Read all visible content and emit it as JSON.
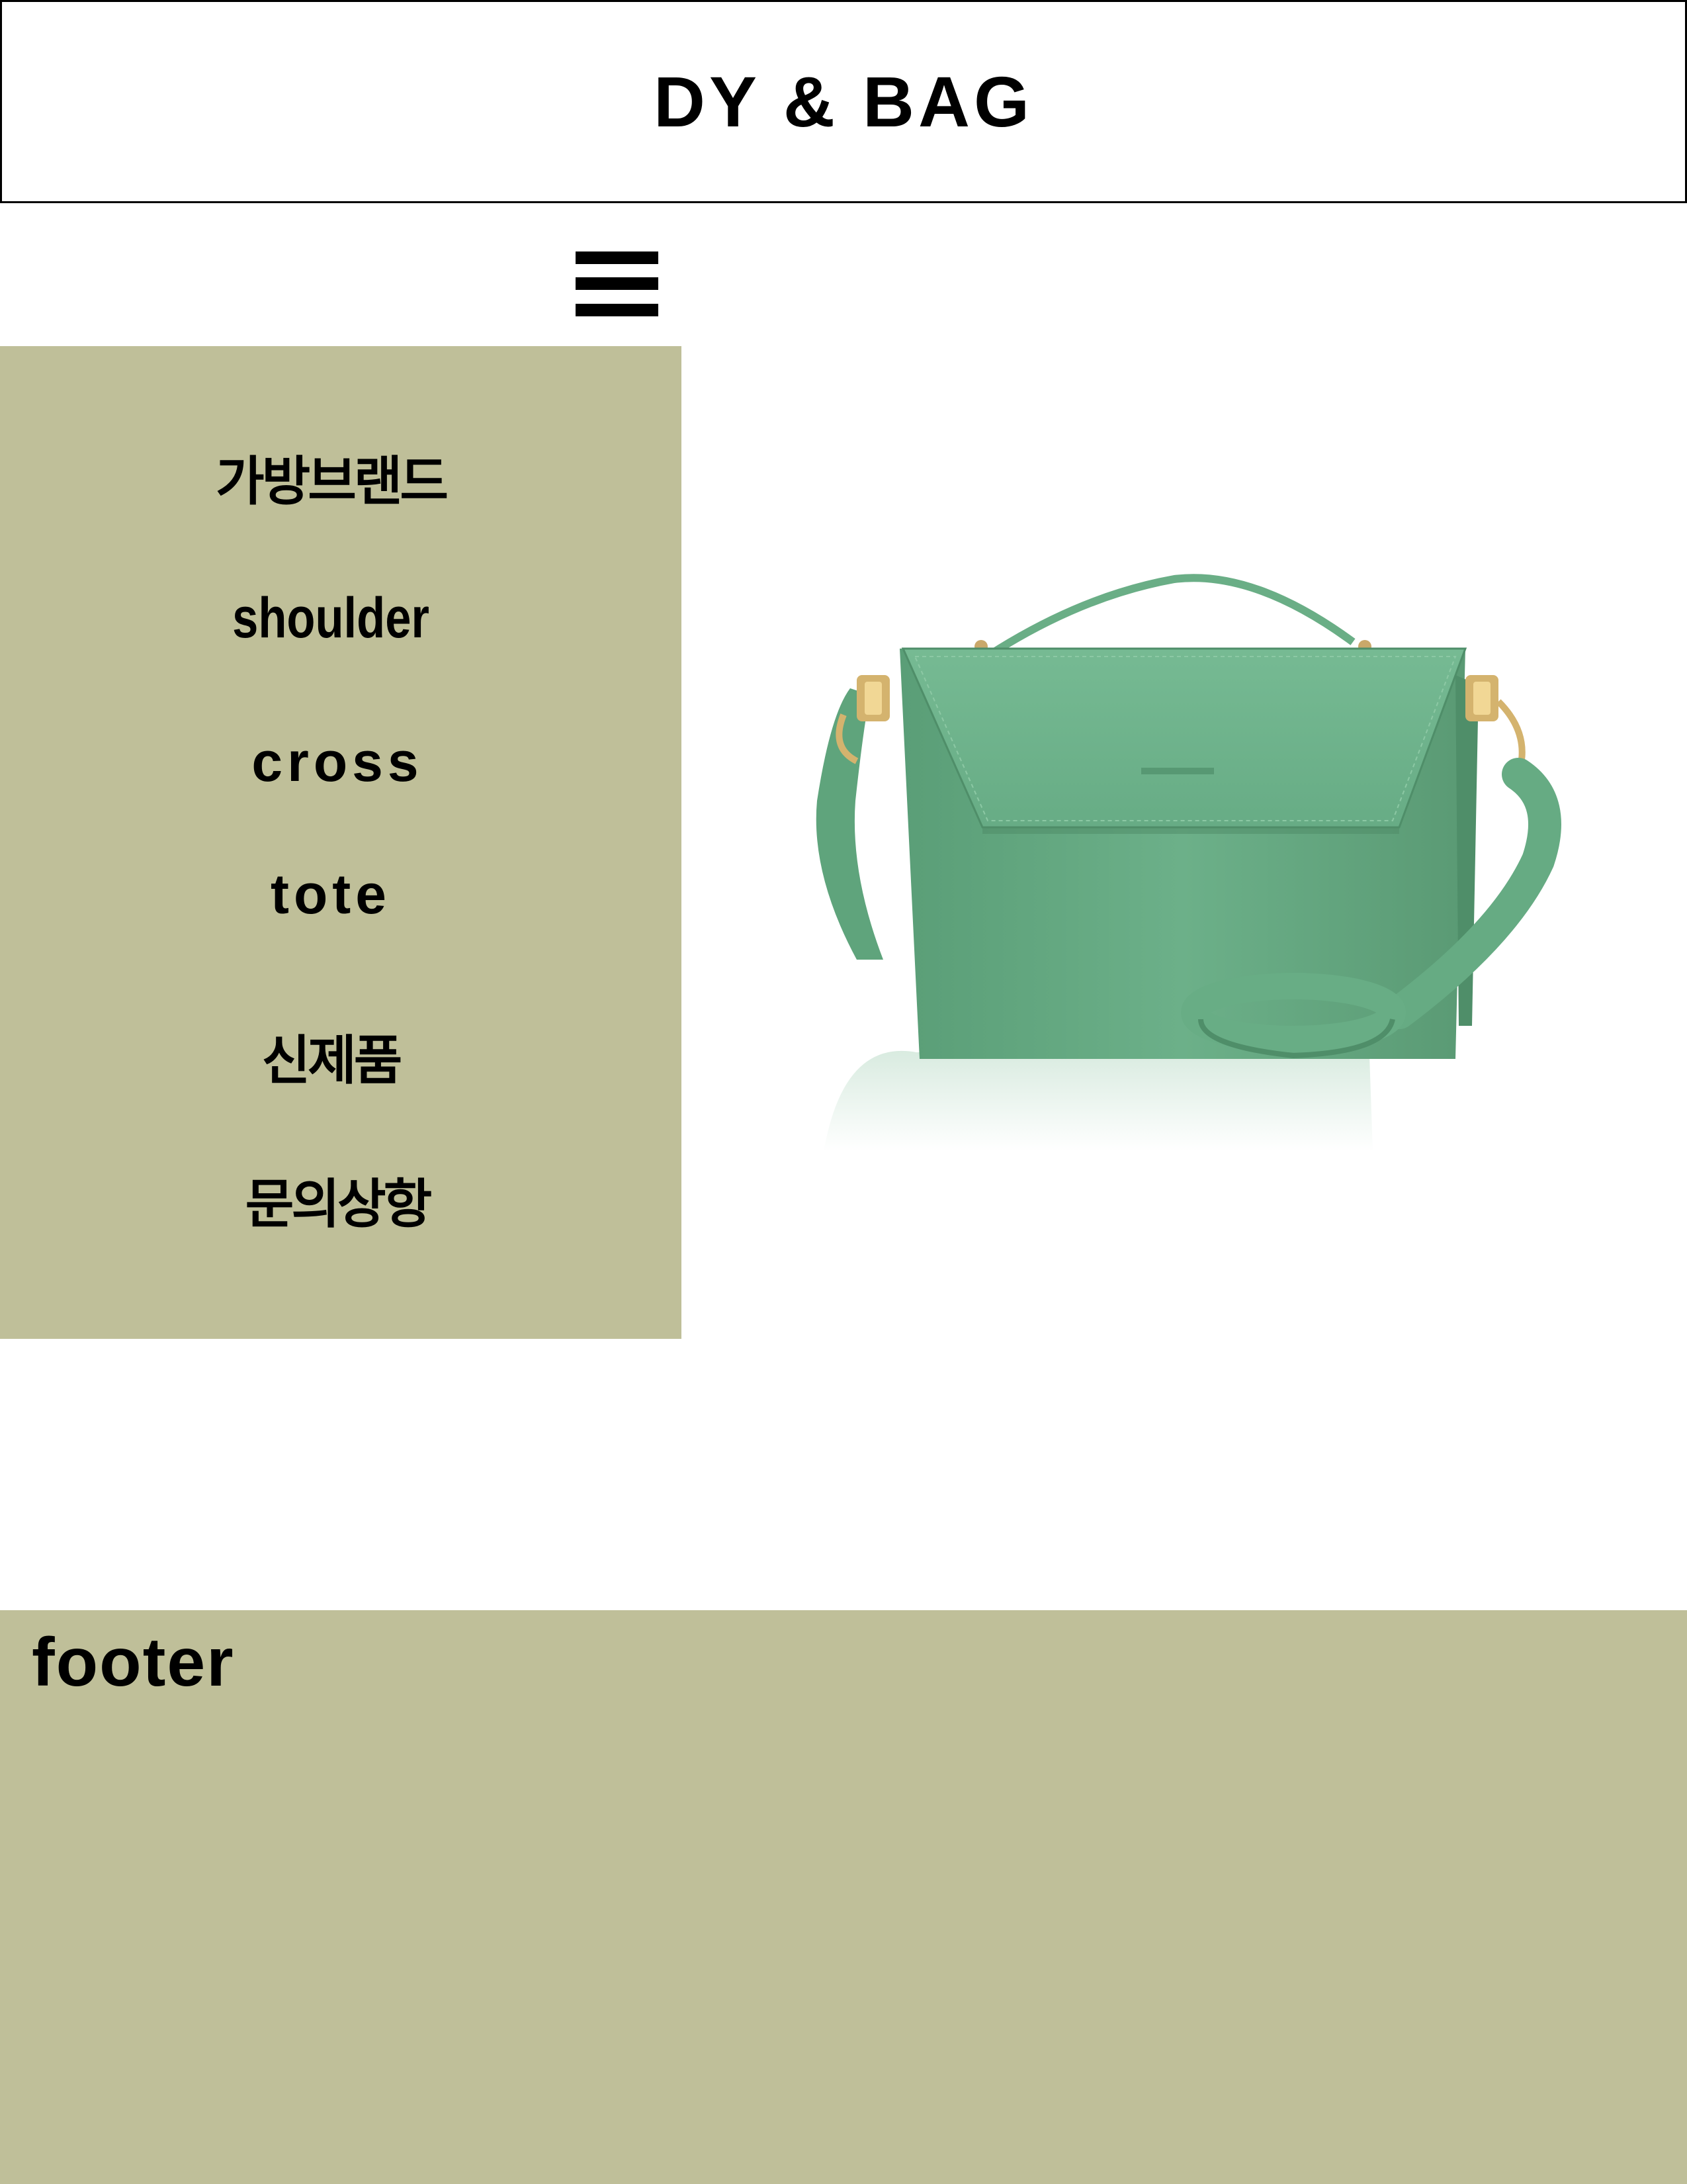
{
  "header": {
    "title": "DY & BAG"
  },
  "menu_toggle": {
    "icon": "hamburger-menu-icon"
  },
  "sidebar": {
    "items": [
      {
        "label": "가방브랜드"
      },
      {
        "label": "shoulder"
      },
      {
        "label": "cross"
      },
      {
        "label": "tote"
      },
      {
        "label": "신제품"
      },
      {
        "label": "문의상항"
      }
    ]
  },
  "product": {
    "color": "#6aae86"
  },
  "footer": {
    "label": "footer"
  },
  "colors": {
    "panel": "#bfbf99",
    "border": "#000000",
    "background": "#ffffff"
  }
}
